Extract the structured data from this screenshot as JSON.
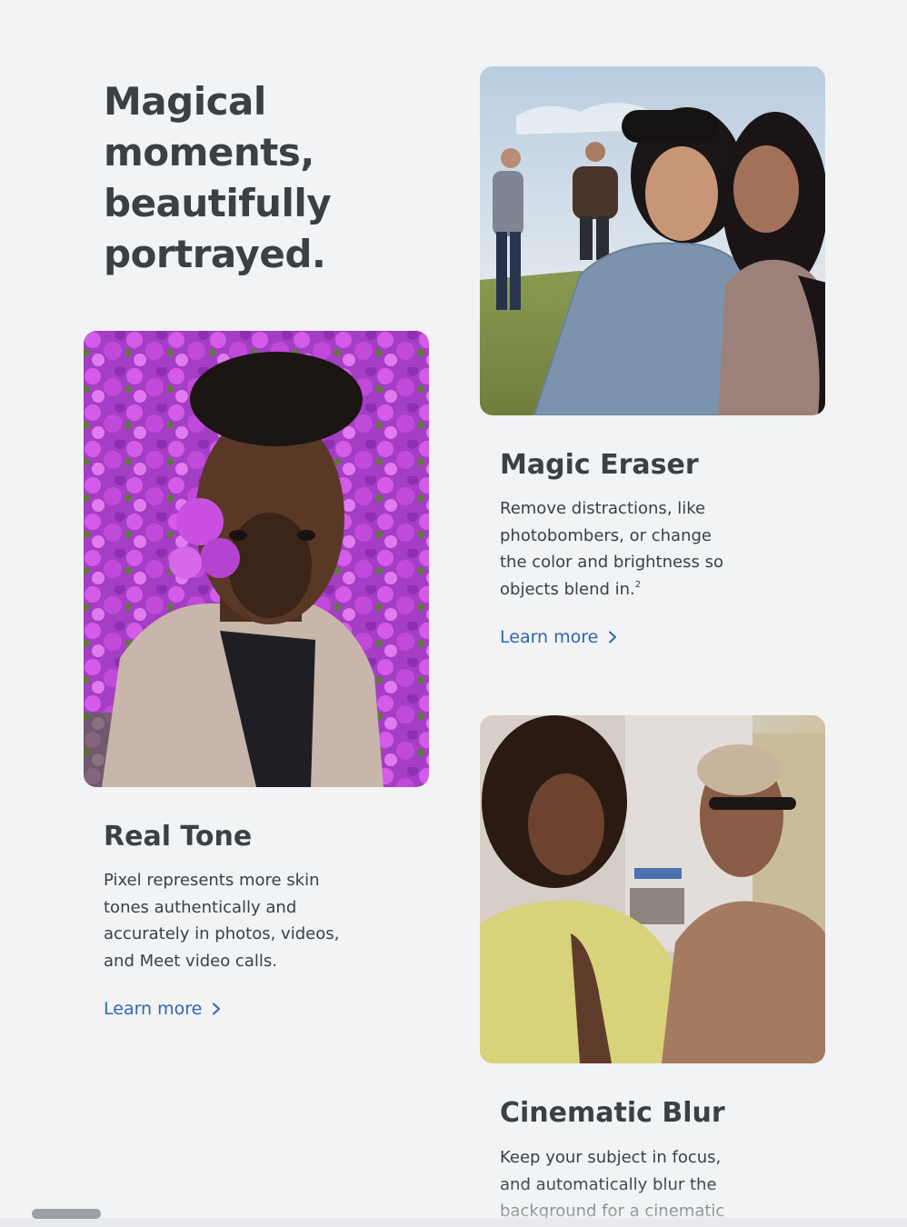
{
  "headline": {
    "line1": "Magical",
    "line2": "moments,",
    "line3": "beautifully",
    "line4": "portrayed."
  },
  "features": [
    {
      "title": "Magic Eraser",
      "description": "Remove distractions, like photobombers, or change the color and brightness so objects blend in.",
      "footnote": "2",
      "link_label": "Learn more"
    },
    {
      "title": "Real Tone",
      "description": "Pixel represents more skin tones authentically and accurately in photos, videos, and Meet video calls.",
      "link_label": "Learn more"
    },
    {
      "title": "Cinematic Blur",
      "description": "Keep your subject in focus, and automatically blur the background for a cinematic"
    }
  ],
  "colors": {
    "background": "#f1f3f4",
    "text": "#3c4043",
    "link": "#2f66b3"
  },
  "icons": {
    "link_chevron": "chevron-right-icon"
  }
}
